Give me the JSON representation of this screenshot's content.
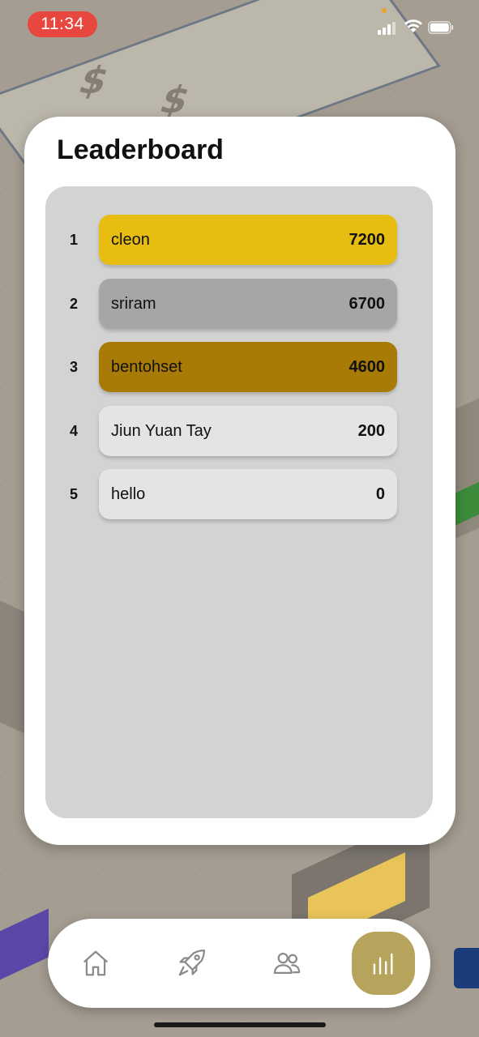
{
  "status_bar": {
    "time": "11:34"
  },
  "leaderboard": {
    "title": "Leaderboard",
    "entries": [
      {
        "rank": "1",
        "name": "cleon",
        "score": "7200",
        "color": "#e8bd12"
      },
      {
        "rank": "2",
        "name": "sriram",
        "score": "6700",
        "color": "#a6a6a6"
      },
      {
        "rank": "3",
        "name": "bentohset",
        "score": "4600",
        "color": "#a87a06"
      },
      {
        "rank": "4",
        "name": "Jiun Yuan Tay",
        "score": "200",
        "color": "#e5e4e2"
      },
      {
        "rank": "5",
        "name": "hello",
        "score": "0",
        "color": "#e5e4e2"
      }
    ]
  },
  "tabbar": {
    "tabs": [
      {
        "icon": "home-icon",
        "active": false
      },
      {
        "icon": "rocket-icon",
        "active": false
      },
      {
        "icon": "users-icon",
        "active": false
      },
      {
        "icon": "bar-chart-icon",
        "active": true
      }
    ],
    "active_color": "#b6a35c"
  }
}
